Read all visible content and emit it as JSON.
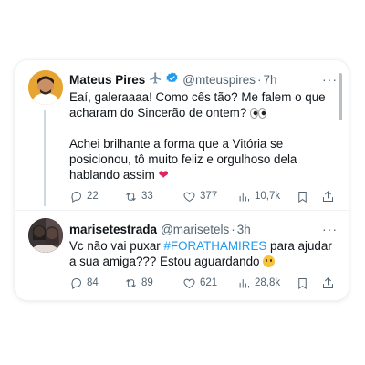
{
  "tweets": [
    {
      "author": "Mateus Pires",
      "badges": [
        "airplane-emoji",
        "verified-badge"
      ],
      "handle": "@mteuspires",
      "time": "7h",
      "paragraphs": [
        "Eaí, galeraaaa! Como cês tão? Me falem o que acharam do Sincerão de ontem?",
        "Achei brilhante a forma que a Vitória se posicionou, tô muito feliz e orgulhoso dela hablando assim"
      ],
      "stats": {
        "replies": "22",
        "retweets": "33",
        "likes": "377",
        "views": "10,7k"
      }
    },
    {
      "author": "marisetestrada",
      "handle": "@marisetels",
      "time": "3h",
      "text_before": "Vc não vai puxar ",
      "hashtag": "#FORATHAMIRES",
      "text_after": " para ajudar a sua amiga??? Estou aguardando",
      "stats": {
        "replies": "84",
        "retweets": "89",
        "likes": "621",
        "views": "28,8k"
      }
    }
  ],
  "ui": {
    "more_label": "···",
    "dot": "·"
  },
  "colors": {
    "link": "#1d9bf0",
    "secondary": "#536471",
    "verified": "#1d9bf0",
    "heart": "#e0245e"
  }
}
